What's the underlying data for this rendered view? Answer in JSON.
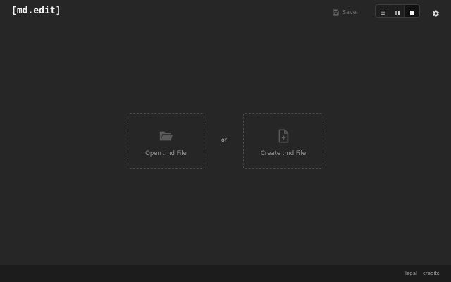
{
  "header": {
    "logo": "[md.edit]",
    "save_label": "Save",
    "view_modes": [
      {
        "name": "editor",
        "icon": "editor-view-icon",
        "active": false
      },
      {
        "name": "split",
        "icon": "split-view-icon",
        "active": false
      },
      {
        "name": "preview",
        "icon": "preview-view-icon",
        "active": true
      }
    ],
    "settings_icon": "gear-icon"
  },
  "main": {
    "open_label": "Open .md File",
    "open_icon": "folder-open-icon",
    "separator": "or",
    "create_label": "Create .md File",
    "create_icon": "file-plus-icon"
  },
  "footer": {
    "links": [
      "legal",
      "credits"
    ]
  },
  "colors": {
    "background": "#262626",
    "footer": "#1c1c1c",
    "text": "#f2f2f2",
    "muted": "#6f6f6f",
    "border": "#4a4a4a"
  }
}
